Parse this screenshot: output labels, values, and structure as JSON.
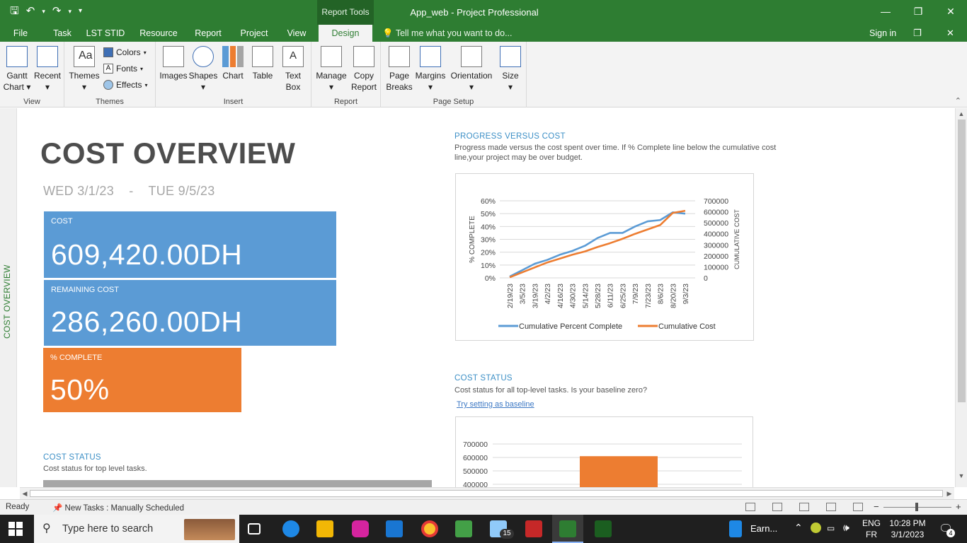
{
  "window": {
    "context_tab": "Report Tools",
    "title": "App_web - Project Professional",
    "minimize_glyph": "—",
    "restore_glyph": "❐",
    "close_glyph": "✕"
  },
  "qat": {
    "save_icon": "save-icon",
    "undo_icon": "undo-icon",
    "redo_icon": "redo-icon"
  },
  "menu": {
    "tabs": [
      "File",
      "Task",
      "LST STID",
      "Resource",
      "Report",
      "Project",
      "View",
      "Design"
    ],
    "active": "Design",
    "tell_me": "Tell me what you want to do...",
    "sign_in": "Sign in"
  },
  "ribbon": {
    "view": {
      "label": "View",
      "gantt": "Gantt",
      "gantt2": "Chart",
      "recent": "Recent"
    },
    "themes": {
      "label": "Themes",
      "themes": "Themes",
      "colors": "Colors",
      "fonts": "Fonts",
      "effects": "Effects"
    },
    "insert": {
      "label": "Insert",
      "images": "Images",
      "shapes": "Shapes",
      "chart": "Chart",
      "table": "Table",
      "textbox1": "Text",
      "textbox2": "Box"
    },
    "report": {
      "label": "Report",
      "manage": "Manage",
      "copy1": "Copy",
      "copy2": "Report"
    },
    "page_setup": {
      "label": "Page Setup",
      "breaks1": "Page",
      "breaks2": "Breaks",
      "margins": "Margins",
      "orientation": "Orientation",
      "size": "Size"
    }
  },
  "sidebar": {
    "label": "COST OVERVIEW"
  },
  "report": {
    "title": "COST OVERVIEW",
    "date_start": "WED 3/1/23",
    "date_sep": "-",
    "date_end": "TUE 9/5/23",
    "tiles": {
      "cost_label": "COST",
      "cost_value": "609,420.00DH",
      "remaining_label": "REMAINING COST",
      "remaining_value": "286,260.00DH",
      "complete_label": "% COMPLETE",
      "complete_value": "50%"
    },
    "cost_status_left": {
      "heading": "COST STATUS",
      "desc": "Cost status for top level tasks."
    },
    "progress": {
      "heading": "PROGRESS VERSUS COST",
      "desc1": "Progress made versus the cost spent over time. If % Complete line below the cumulative cost",
      "desc2": "line,your project may be over budget."
    },
    "cost_status_right": {
      "heading": "COST STATUS",
      "desc": "Cost status for all top-level tasks. Is your baseline zero?",
      "link": "Try setting as baseline"
    }
  },
  "chart_data": [
    {
      "type": "line",
      "ylabel": "% COMPLETE",
      "y2label": "CUMULATIVE COST",
      "ylim": [
        0,
        60
      ],
      "y2lim": [
        0,
        700000
      ],
      "y_ticks": [
        "0%",
        "10%",
        "20%",
        "30%",
        "40%",
        "50%",
        "60%"
      ],
      "y2_ticks": [
        "0",
        "100000",
        "200000",
        "300000",
        "400000",
        "500000",
        "600000",
        "700000"
      ],
      "categories": [
        "2/19/23",
        "3/5/23",
        "3/19/23",
        "4/2/23",
        "4/16/23",
        "4/30/23",
        "5/14/23",
        "5/28/23",
        "6/11/23",
        "6/25/23",
        "7/9/23",
        "7/23/23",
        "8/6/23",
        "8/20/23",
        "9/3/23"
      ],
      "grid": true,
      "legend": "bottom",
      "series": [
        {
          "name": "Cumulative Percent Complete",
          "axis": "left",
          "color": "#5b9bd5",
          "values": [
            1,
            6,
            11,
            14,
            18,
            21,
            25,
            31,
            35,
            35,
            40,
            44,
            45,
            51,
            50
          ]
        },
        {
          "name": "Cumulative Cost",
          "axis": "right",
          "color": "#ed7d31",
          "values": [
            5000,
            50000,
            95000,
            140000,
            175000,
            210000,
            240000,
            280000,
            315000,
            355000,
            400000,
            440000,
            480000,
            590000,
            609420
          ]
        }
      ]
    },
    {
      "type": "bar",
      "ylim": [
        400000,
        700000
      ],
      "y_ticks": [
        "400000",
        "500000",
        "600000",
        "700000"
      ],
      "grid": true,
      "series": [
        {
          "color": "#ed7d31",
          "values": [
            609420
          ]
        }
      ]
    }
  ],
  "statusbar": {
    "ready": "Ready",
    "new_tasks": "New Tasks : Manually Scheduled"
  },
  "taskbar": {
    "search": "Type here to search",
    "app_label": "Earn...",
    "lang1": "ENG",
    "lang2": "FR",
    "time": "10:28 PM",
    "date": "3/1/2023",
    "mail_badge": "15",
    "notif_badge": "4"
  },
  "colors": {
    "brand": "#2e7d32",
    "tile_blue": "#5b9bd5",
    "tile_orange": "#ed7d31",
    "heading_blue": "#3c8fc6"
  }
}
